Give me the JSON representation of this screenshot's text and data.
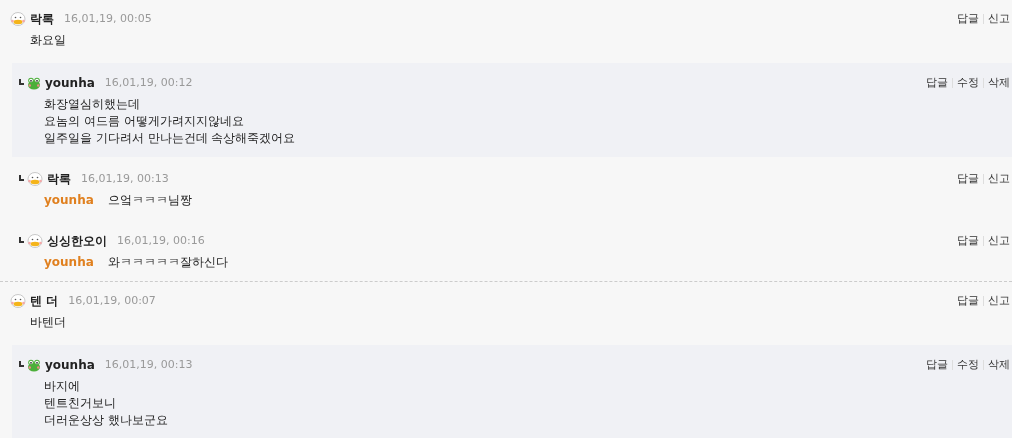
{
  "threads": [
    {
      "comment": {
        "kind": "duck",
        "author": "락록",
        "date": "16,01,19, 00:05",
        "lines": [
          "화요일"
        ],
        "actions": [
          "답글",
          "신고"
        ]
      },
      "replies": [
        {
          "highlighted": true,
          "kind": "frog",
          "author": "younha",
          "date": "16,01,19, 00:12",
          "lines": [
            "화장열심히했는데",
            "요놈의 여드름 어떻게가려지지않네요",
            "일주일을 기다려서 만나는건데 속상해죽겠어요"
          ],
          "actions": [
            "답글",
            "수정",
            "삭제"
          ]
        },
        {
          "highlighted": false,
          "kind": "duck",
          "author": "락록",
          "date": "16,01,19, 00:13",
          "mention": "younha",
          "lines": [
            "으엌ㅋㅋㅋ님짱"
          ],
          "actions": [
            "답글",
            "신고"
          ]
        },
        {
          "highlighted": false,
          "kind": "duck",
          "author": "싱싱한오이",
          "date": "16,01,19, 00:16",
          "mention": "younha",
          "lines": [
            "와ㅋㅋㅋㅋㅋ잘하신다"
          ],
          "actions": [
            "답글",
            "신고"
          ]
        }
      ]
    },
    {
      "comment": {
        "kind": "duck",
        "author": "텐 더",
        "date": "16,01,19, 00:07",
        "lines": [
          "바텐더"
        ],
        "actions": [
          "답글",
          "신고"
        ]
      },
      "replies": [
        {
          "highlighted": true,
          "kind": "frog",
          "author": "younha",
          "date": "16,01,19, 00:13",
          "lines": [
            "바지에",
            "텐트친거보니",
            "더러운상상 했나보군요"
          ],
          "actions": [
            "답글",
            "수정",
            "삭제"
          ]
        }
      ]
    }
  ]
}
